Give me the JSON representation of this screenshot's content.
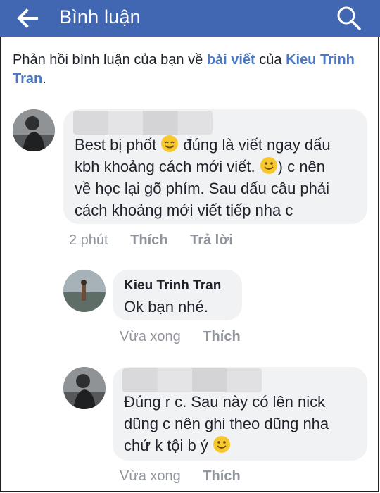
{
  "header": {
    "title": "Bình luận",
    "back_icon": "back-arrow-icon",
    "search_icon": "search-icon",
    "background": "#4267b2"
  },
  "context": {
    "prefix": "Phản hồi bình luận của bạn về ",
    "post_link": "bài viết",
    "middle": " của ",
    "author_link": "Kieu Trinh Tran",
    "suffix": "."
  },
  "comments": [
    {
      "name_hidden": true,
      "text_a": "Best bị phốt ",
      "text_b": " đúng là viết ngay dấu\nkbh khoảng cách mới viết. ",
      "text_c": ") c nên\nvề học lại gõ phím. Sau dấu câu phải\ncách khoảng mới viết tiếp nha c",
      "time": "2 phút",
      "like": "Thích",
      "reply": "Trả lời"
    },
    {
      "author": "Kieu Trinh Tran",
      "text": "Ok bạn nhé.",
      "time": "Vừa xong",
      "like": "Thích"
    },
    {
      "name_hidden": true,
      "text_a": "Đúng r c. Sau này có lên nick\ndũng c nên ghi theo dũng nha\nchứ k tội b ý ",
      "time": "Vừa xong",
      "like": "Thích"
    }
  ]
}
